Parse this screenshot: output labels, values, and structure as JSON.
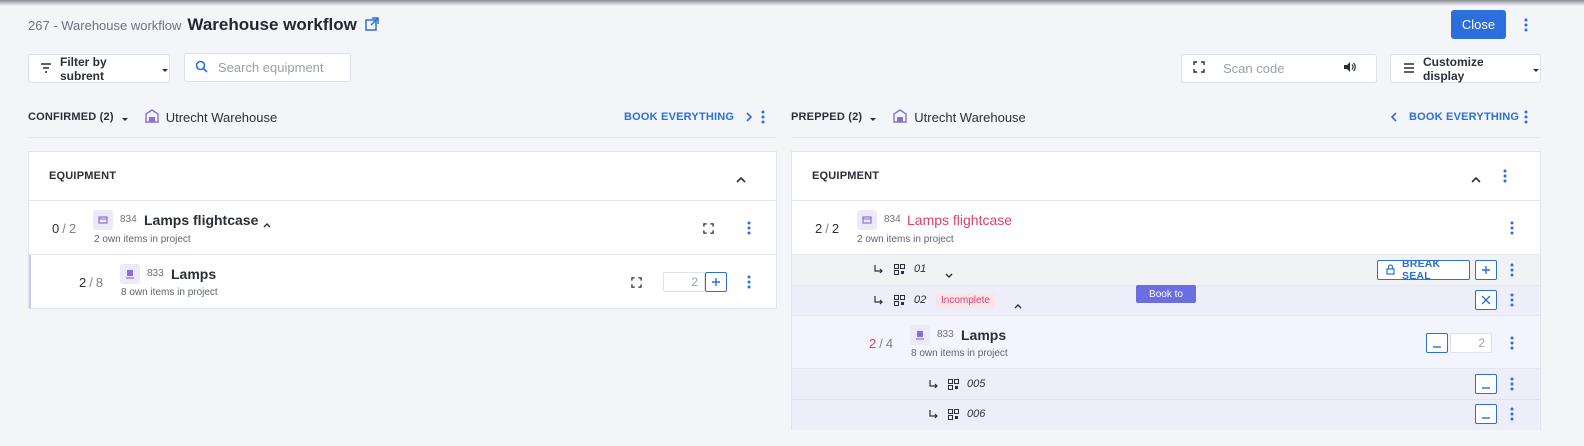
{
  "header": {
    "breadcrumb": "267 - Warehouse workflow",
    "title": "Warehouse workflow",
    "close_label": "Close"
  },
  "toolbar": {
    "filter_label": "Filter by subrent",
    "search_placeholder": "Search equipment",
    "scan_placeholder": "Scan code",
    "customize_label": "Customize display"
  },
  "left": {
    "status_label": "CONFIRMED (2)",
    "warehouse": "Utrecht Warehouse",
    "book_label": "BOOK EVERYTHING",
    "section_title": "EQUIPMENT",
    "items": [
      {
        "done": "0",
        "total": "2",
        "code": "834",
        "name": "Lamps flightcase",
        "subtitle": "2 own items in project"
      },
      {
        "done": "2",
        "total": "8",
        "code": "833",
        "name": "Lamps",
        "subtitle": "8 own items in project",
        "qty": "2"
      }
    ]
  },
  "right": {
    "status_label": "PREPPED (2)",
    "warehouse": "Utrecht Warehouse",
    "book_label": "BOOK EVERYTHING",
    "section_title": "EQUIPMENT",
    "case": {
      "done": "2",
      "total": "2",
      "code": "834",
      "name": "Lamps flightcase",
      "subtitle": "2 own items in project"
    },
    "case_units": [
      {
        "id": "01",
        "action": "BREAK SEAL"
      },
      {
        "id": "02",
        "badge": "Incomplete",
        "tooltip": "Book to"
      }
    ],
    "lamps": {
      "done": "2",
      "total": "4",
      "code": "833",
      "name": "Lamps",
      "subtitle": "8 own items in project",
      "qty": "2"
    },
    "lamp_units": [
      {
        "id": "005"
      },
      {
        "id": "006"
      }
    ]
  },
  "colors": {
    "accent": "#2a6fdb",
    "alert": "#e03e6b",
    "icon_bg": "#eceaf8",
    "tooltip_bg": "#6b6ee0"
  }
}
